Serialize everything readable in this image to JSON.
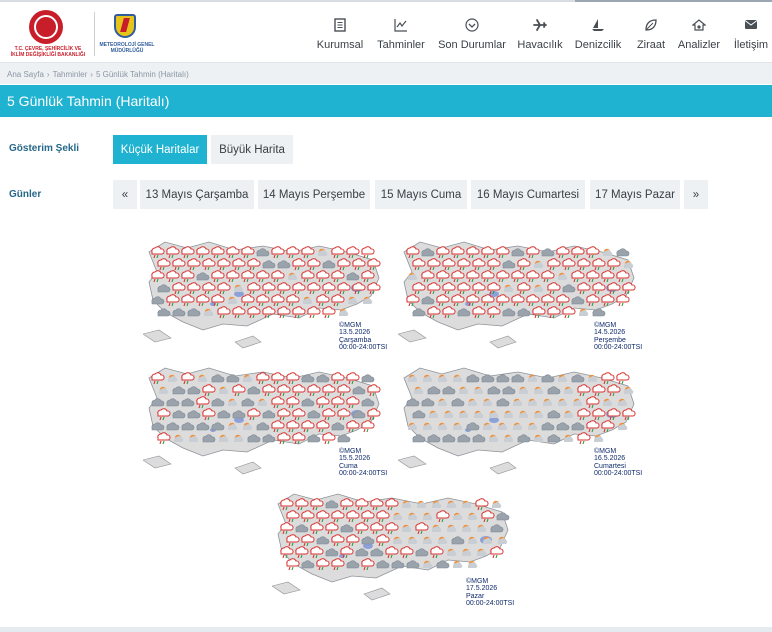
{
  "header": {
    "ministry_logo_text": "T.C. ÇEVRE, ŞEHİRCİLİK VE İKLİM DEĞİŞİKLİĞİ BAKANLIĞI",
    "mgm_logo_label": "METEOROLOJİ",
    "mgm_logo_text": "METEOROLOJİ GENEL MÜDÜRLÜĞÜ",
    "nav": [
      {
        "label": "Kurumsal",
        "icon": "document-icon"
      },
      {
        "label": "Tahminler",
        "icon": "chart-icon"
      },
      {
        "label": "Son Durumlar",
        "icon": "chevron-circle-icon"
      },
      {
        "label": "Havacılık",
        "icon": "airplane-icon"
      },
      {
        "label": "Denizcilik",
        "icon": "sailboat-icon"
      },
      {
        "label": "Ziraat",
        "icon": "leaf-icon"
      },
      {
        "label": "Analizler",
        "icon": "house-chart-icon"
      },
      {
        "label": "İletişim",
        "icon": "envelope-icon"
      }
    ]
  },
  "breadcrumb": [
    "Ana Sayfa",
    "Tahminler",
    "5 Günlük Tahmin (Haritalı)"
  ],
  "page_title": "5 Günlük Tahmin (Haritalı)",
  "display_mode": {
    "label": "Gösterim Şekli",
    "options": [
      "Küçük Haritalar",
      "Büyük Harita"
    ],
    "selected": "Küçük Haritalar"
  },
  "days": {
    "label": "Günler",
    "prev": "«",
    "next": "»",
    "items": [
      "13 Mayıs Çarşamba",
      "14 Mayıs Perşembe",
      "15 Mayıs Cuma",
      "16 Mayıs Cumartesi",
      "17 Mayıs Pazar"
    ]
  },
  "maps": [
    {
      "copyright": "©MGM",
      "date": "13.5.2026",
      "day": "Çarşamba",
      "time": "00:00-24:00TSI"
    },
    {
      "copyright": "©MGM",
      "date": "14.5.2026",
      "day": "Perşembe",
      "time": "00:00-24:00TSI"
    },
    {
      "copyright": "©MGM",
      "date": "15.5.2026",
      "day": "Cuma",
      "time": "00:00-24:00TSI"
    },
    {
      "copyright": "©MGM",
      "date": "16.5.2026",
      "day": "Cumartesi",
      "time": "00:00-24:00TSI"
    },
    {
      "copyright": "©MGM",
      "date": "17.5.2026",
      "day": "Pazar",
      "time": "00:00-24:00TSI"
    }
  ],
  "colors": {
    "accent": "#1fb3d1",
    "label": "#26688a",
    "rain_symbol": "#d9322f",
    "sun_symbol": "#f0913a",
    "cloud_symbol": "#7d8893",
    "lake": "#8ea0d8",
    "land": "#dcdcdc"
  }
}
